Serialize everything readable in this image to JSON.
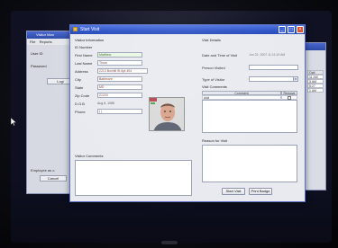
{
  "window": {
    "title": "Start Visit"
  },
  "visitor_info": {
    "section_title": "Visitor Information",
    "id_label": "ID Number",
    "id_value": "",
    "first_name_label": "First Name",
    "first_name_value": "Matthew",
    "last_name_label": "Last Name",
    "last_name_value": "Thum",
    "address_label": "Address",
    "address_value": "2213 Boxhill St Apt 404",
    "city_label": "City",
    "city_value": "Baltimore",
    "state_label": "State",
    "state_value": "MD",
    "zip_label": "Zip Code",
    "zip_value": "21224",
    "dob_label": "D.O.B",
    "dob_value": "Aug 6, 1985",
    "phone_label": "Phone",
    "phone_value": "(   )"
  },
  "visit_details": {
    "section_title": "Visit Details",
    "datetime_label": "Date and Time of Visit",
    "datetime_value": "Jun 22, 2007 11:11:19 AM",
    "person_visited_label": "Person Visited",
    "type_label": "Type of Visitor",
    "comments_title": "Visit Comments",
    "comments_columns": [
      "Comment",
      "Remove"
    ],
    "comments_rows": [
      {
        "comment": "Add",
        "remove": false
      }
    ],
    "reason_label": "Reason for Visit"
  },
  "visitor_comments_label": "Visitor Comments",
  "buttons": {
    "start_visit": "Start Visit",
    "print_badge": "Print Badge"
  },
  "title_controls": {
    "minimize": "_",
    "maximize": "□",
    "close": "×"
  },
  "background_left": {
    "title": "Visitor Man",
    "menu": [
      "File",
      "Reports"
    ],
    "user_label": "User ID",
    "password_label": "Password",
    "login_button": "Logi",
    "note": "Employee as o",
    "cancel_button": "Cancel"
  },
  "background_right": {
    "header": "Opti",
    "cells": [
      "11 AM",
      "3 AM",
      "5:27",
      "1 AM"
    ]
  },
  "colors": {
    "titlebar": "#2a52c8",
    "window_bg": "#e8eaf0",
    "close_button": "#d9522f",
    "field_text": "#7a3a3a"
  }
}
